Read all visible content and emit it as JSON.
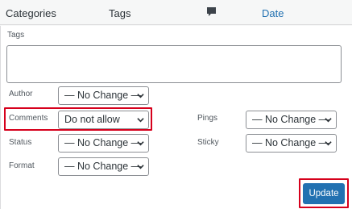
{
  "columns": {
    "categories": "Categories",
    "tags": "Tags",
    "comments_icon": "speech-bubble-icon",
    "date": "Date"
  },
  "bulk_edit": {
    "tags_label": "Tags",
    "tags_value": "",
    "author": {
      "label": "Author",
      "value": "— No Change —"
    },
    "comments": {
      "label": "Comments",
      "value": "Do not allow"
    },
    "status": {
      "label": "Status",
      "value": "— No Change —"
    },
    "format": {
      "label": "Format",
      "value": "— No Change —"
    },
    "pings": {
      "label": "Pings",
      "value": "— No Change —"
    },
    "sticky": {
      "label": "Sticky",
      "value": "— No Change —"
    },
    "update_label": "Update"
  },
  "colors": {
    "link": "#2271b1",
    "primary_button": "#2271b1",
    "highlight": "#d6001c"
  }
}
